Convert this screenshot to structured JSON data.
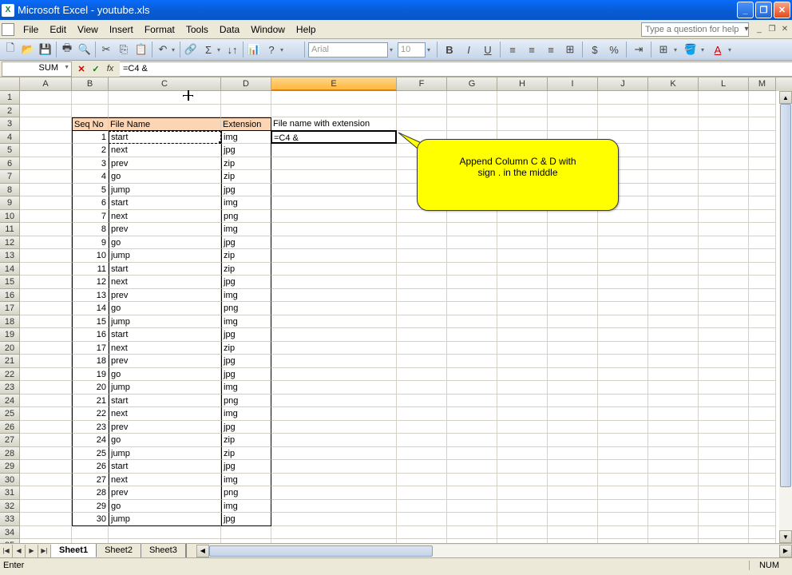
{
  "titlebar": {
    "app": "Microsoft Excel",
    "doc": "youtube.xls"
  },
  "menu": [
    "File",
    "Edit",
    "View",
    "Insert",
    "Format",
    "Tools",
    "Data",
    "Window",
    "Help"
  ],
  "help_placeholder": "Type a question for help",
  "name_box": "SUM",
  "formula_value": "=C4 &",
  "font_name": "Arial",
  "font_size": "10",
  "columns": [
    "A",
    "B",
    "C",
    "D",
    "E",
    "F",
    "G",
    "H",
    "I",
    "J",
    "K",
    "L",
    "M"
  ],
  "active_column": "E",
  "headers": {
    "seq": "Seq No",
    "fname": "File Name",
    "ext": "Extension",
    "full": "File name with extension"
  },
  "rows": [
    {
      "n": 1,
      "f": "start",
      "e": "img"
    },
    {
      "n": 2,
      "f": "next",
      "e": "jpg"
    },
    {
      "n": 3,
      "f": "prev",
      "e": "zip"
    },
    {
      "n": 4,
      "f": "go",
      "e": "zip"
    },
    {
      "n": 5,
      "f": "jump",
      "e": "jpg"
    },
    {
      "n": 6,
      "f": "start",
      "e": "img"
    },
    {
      "n": 7,
      "f": "next",
      "e": "png"
    },
    {
      "n": 8,
      "f": "prev",
      "e": "img"
    },
    {
      "n": 9,
      "f": "go",
      "e": "jpg"
    },
    {
      "n": 10,
      "f": "jump",
      "e": "zip"
    },
    {
      "n": 11,
      "f": "start",
      "e": "zip"
    },
    {
      "n": 12,
      "f": "next",
      "e": "jpg"
    },
    {
      "n": 13,
      "f": "prev",
      "e": "img"
    },
    {
      "n": 14,
      "f": "go",
      "e": "png"
    },
    {
      "n": 15,
      "f": "jump",
      "e": "img"
    },
    {
      "n": 16,
      "f": "start",
      "e": "jpg"
    },
    {
      "n": 17,
      "f": "next",
      "e": "zip"
    },
    {
      "n": 18,
      "f": "prev",
      "e": "jpg"
    },
    {
      "n": 19,
      "f": "go",
      "e": "jpg"
    },
    {
      "n": 20,
      "f": "jump",
      "e": "img"
    },
    {
      "n": 21,
      "f": "start",
      "e": "png"
    },
    {
      "n": 22,
      "f": "next",
      "e": "img"
    },
    {
      "n": 23,
      "f": "prev",
      "e": "jpg"
    },
    {
      "n": 24,
      "f": "go",
      "e": "zip"
    },
    {
      "n": 25,
      "f": "jump",
      "e": "zip"
    },
    {
      "n": 26,
      "f": "start",
      "e": "jpg"
    },
    {
      "n": 27,
      "f": "next",
      "e": "img"
    },
    {
      "n": 28,
      "f": "prev",
      "e": "png"
    },
    {
      "n": 29,
      "f": "go",
      "e": "img"
    },
    {
      "n": 30,
      "f": "jump",
      "e": "jpg"
    }
  ],
  "editing_value": "=C4 &",
  "callout": {
    "l1": "Append Column C & D with",
    "l2": "sign . in the middle"
  },
  "sheets": [
    "Sheet1",
    "Sheet2",
    "Sheet3"
  ],
  "active_sheet": "Sheet1",
  "status_mode": "Enter",
  "status_num": "NUM"
}
